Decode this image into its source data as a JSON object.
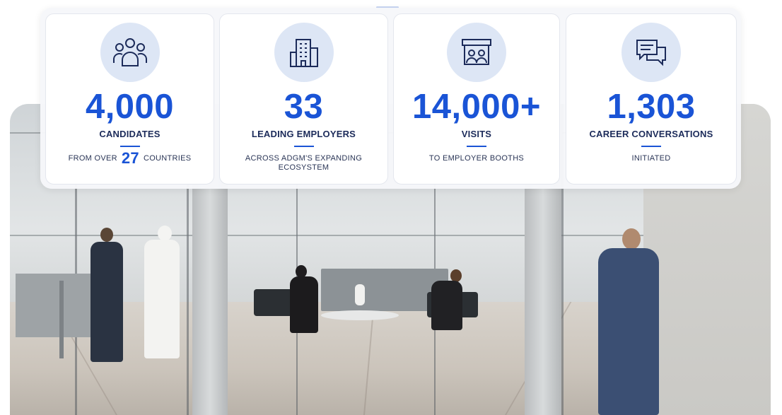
{
  "stats": [
    {
      "icon": "people-group-icon",
      "value": "4,000",
      "label": "CANDIDATES",
      "sub_prefix": "FROM OVER",
      "sub_number": "27",
      "sub_suffix": "COUNTRIES"
    },
    {
      "icon": "office-building-icon",
      "value": "33",
      "label": "LEADING EMPLOYERS",
      "sub": "ACROSS ADGM'S EXPANDING ECOSYSTEM"
    },
    {
      "icon": "booth-icon",
      "value": "14,000+",
      "label": "VISITS",
      "sub": "TO EMPLOYER BOOTHS"
    },
    {
      "icon": "chat-bubbles-icon",
      "value": "1,303",
      "label": "CAREER CONVERSATIONS",
      "sub": "INITIATED"
    }
  ],
  "colors": {
    "accent": "#1a54d6",
    "heading": "#1c2b5a",
    "icon_bg": "#dde6f5"
  }
}
